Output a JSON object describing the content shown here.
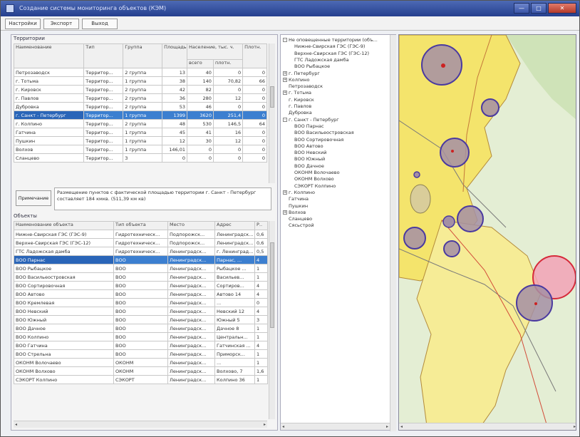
{
  "window": {
    "title": "Создание системы мониторинга объектов (КЭМ)",
    "controls": [
      "—",
      "□",
      "✕"
    ]
  },
  "menu": {
    "tabs": [
      "Настройки",
      "Экспорт",
      "Выход"
    ]
  },
  "territories": {
    "group_label": "Территории",
    "headers": [
      "Наименование",
      "Тип",
      "Группа",
      "Площадь",
      "Население, тыс. ч.",
      "Плотн."
    ],
    "subheaders": [
      "всего",
      "плотн."
    ],
    "rows": [
      [
        "Петрозаводск",
        "Территор...",
        "2 группа",
        "13",
        "40",
        "0",
        "0"
      ],
      [
        "г. Тотьма",
        "Территор...",
        "1 группа",
        "38",
        "140",
        "70,82",
        "66"
      ],
      [
        "г. Кировск",
        "Территор...",
        "2 группа",
        "42",
        "82",
        "0",
        "0"
      ],
      [
        "г. Павлов",
        "Территор...",
        "2 группа",
        "36",
        "280",
        "12",
        "0"
      ],
      [
        "Дубровка",
        "Территор...",
        "2 группа",
        "53",
        "46",
        "0",
        "0"
      ],
      [
        "г. Санкт - Петербург",
        "Территор...",
        "1 группа",
        "1399",
        "3620",
        "251,4",
        "0"
      ],
      [
        "г. Колпино",
        "Территор...",
        "2 группа",
        "48",
        "530",
        "146,5",
        "64"
      ],
      [
        "Гатчина",
        "Территор...",
        "1 группа",
        "45",
        "41",
        "16",
        "0"
      ],
      [
        "Пушкин",
        "Территор...",
        "1 группа",
        "12",
        "30",
        "12",
        "0"
      ],
      [
        "Волхов",
        "Территор...",
        "1 группа",
        "146,01",
        "0",
        "0",
        "0"
      ],
      [
        "Сланцево",
        "Территор...",
        "3",
        "0",
        "0",
        "0",
        "0"
      ]
    ],
    "selected_row": 5
  },
  "note": {
    "label": "Примечание",
    "text": "Размещение пунктов с фактической площадью территории г. Санкт - Петербург составляет 184 кмкв. (511,39 км кв)"
  },
  "objects": {
    "group_label": "Объекты",
    "headers": [
      "Наименование объекта",
      "Тип объекта",
      "Место",
      "Адрес",
      "Р.."
    ],
    "rows": [
      [
        "Нижне-Свирская ГЭС (ГЭС-9)",
        "Гидротехническ...",
        "Подпорожск...",
        "Ленинградск...",
        "0,6"
      ],
      [
        "Верхне-Свирская ГЭС (ГЭС-12)",
        "Гидротехническ...",
        "Подпорожск...",
        "Ленинградск...",
        "0,6"
      ],
      [
        "ГТС Ладожская дамба",
        "Гидротехническ...",
        "Ленинградск...",
        "г. Ленинград...",
        "0,5"
      ],
      [
        "ВОО Парнас",
        "ВОО",
        "Ленинградск...",
        "Парнас, ...",
        "4"
      ],
      [
        "ВОО Рыбацкое",
        "ВОО",
        "Ленинградск...",
        "Рыбацкое ...",
        "1"
      ],
      [
        "ВОО Васильеостровская",
        "ВОО",
        "Ленинградск...",
        "Васильев...",
        "1"
      ],
      [
        "ВОО Сортировочная",
        "ВОО",
        "Ленинградск...",
        "Сортиров...",
        "4"
      ],
      [
        "ВОО Автово",
        "ВОО",
        "Ленинградск...",
        "Автово 14",
        "4"
      ],
      [
        "ВОО Кремлевая",
        "ВОО",
        "Ленинградск...",
        "...",
        "0"
      ],
      [
        "ВОО Невский",
        "ВОО",
        "Ленинградск...",
        "Невский 12",
        "4"
      ],
      [
        "ВОО Южный",
        "ВОО",
        "Ленинградск...",
        "Южный 5",
        "3"
      ],
      [
        "ВОО Дачное",
        "ВОО",
        "Ленинградск...",
        "Дачное 8",
        "1"
      ],
      [
        "ВОО Колпино",
        "ВОО",
        "Ленинградск...",
        "Центральн...",
        "1"
      ],
      [
        "ВОО Гатчина",
        "ВОО",
        "Ленинградск...",
        "Гатчинская ...",
        "4"
      ],
      [
        "ВОО Стрельна",
        "ВОО",
        "Ленинградск...",
        "Приморск...",
        "1"
      ],
      [
        "ОКОНМ Волочаево",
        "ОКОНМ",
        "Ленинградск...",
        "...",
        "1"
      ],
      [
        "ОКОНМ Волхово",
        "ОКОНМ",
        "Ленинградск...",
        "Волхово, 7",
        "1,6"
      ],
      [
        "СЭКОРТ Колпино",
        "СЭКОРТ",
        "Ленинградск...",
        "Колпино 36",
        "1"
      ]
    ],
    "selected_row": 3
  },
  "tree": {
    "items": [
      {
        "text": "Не оповещенные территории (объ...",
        "level": 0,
        "exp": "-"
      },
      {
        "text": "Нижне-Свирская ГЭС (ГЭС-9)",
        "level": 2,
        "exp": ""
      },
      {
        "text": "Верхне-Свирская ГЭС (ГЭС-12)",
        "level": 2,
        "exp": ""
      },
      {
        "text": "ГТС Ладожская дамба",
        "level": 2,
        "exp": ""
      },
      {
        "text": "ВОО Рыбацкое",
        "level": 2,
        "exp": ""
      },
      {
        "text": "г. Петербург",
        "level": 0,
        "exp": "+"
      },
      {
        "text": "Колпино",
        "level": 0,
        "exp": "+"
      },
      {
        "text": "Петрозаводск",
        "level": 1,
        "exp": ""
      },
      {
        "text": "г. Тотьма",
        "level": 0,
        "exp": "+"
      },
      {
        "text": "г. Кировск",
        "level": 1,
        "exp": ""
      },
      {
        "text": "г. Павлов",
        "level": 1,
        "exp": ""
      },
      {
        "text": "Дубровка",
        "level": 1,
        "exp": ""
      },
      {
        "text": "г. Санкт - Петербург",
        "level": 0,
        "exp": "-"
      },
      {
        "text": "ВОО Парнас",
        "level": 2,
        "exp": ""
      },
      {
        "text": "ВОО Васильеостровская",
        "level": 2,
        "exp": ""
      },
      {
        "text": "ВОО Сортировочная",
        "level": 2,
        "exp": ""
      },
      {
        "text": "ВОО Автово",
        "level": 2,
        "exp": ""
      },
      {
        "text": "ВОО Невский",
        "level": 2,
        "exp": ""
      },
      {
        "text": "ВОО Южный",
        "level": 2,
        "exp": ""
      },
      {
        "text": "ВОО Дачное",
        "level": 2,
        "exp": ""
      },
      {
        "text": "ОКОНМ Волочаево",
        "level": 2,
        "exp": ""
      },
      {
        "text": "ОКОНМ Волхово",
        "level": 2,
        "exp": ""
      },
      {
        "text": "СЭКОРТ Колпино",
        "level": 2,
        "exp": ""
      },
      {
        "text": "г. Колпино",
        "level": 0,
        "exp": "+"
      },
      {
        "text": "Гатчина",
        "level": 1,
        "exp": ""
      },
      {
        "text": "Пушкин",
        "level": 1,
        "exp": ""
      },
      {
        "text": "Волхов",
        "level": 0,
        "exp": "+"
      },
      {
        "text": "Сланцево",
        "level": 1,
        "exp": ""
      },
      {
        "text": "Сясьстрой",
        "level": 1,
        "exp": ""
      }
    ]
  },
  "map": {
    "colors": {
      "background": "#e6f0d8",
      "urban": "#f7e86a",
      "circle_fill": "#a48fa4",
      "circle_stroke": "#4a3aa0",
      "alert_fill": "#f2a2b6",
      "alert_stroke": "#d62a3a"
    }
  }
}
